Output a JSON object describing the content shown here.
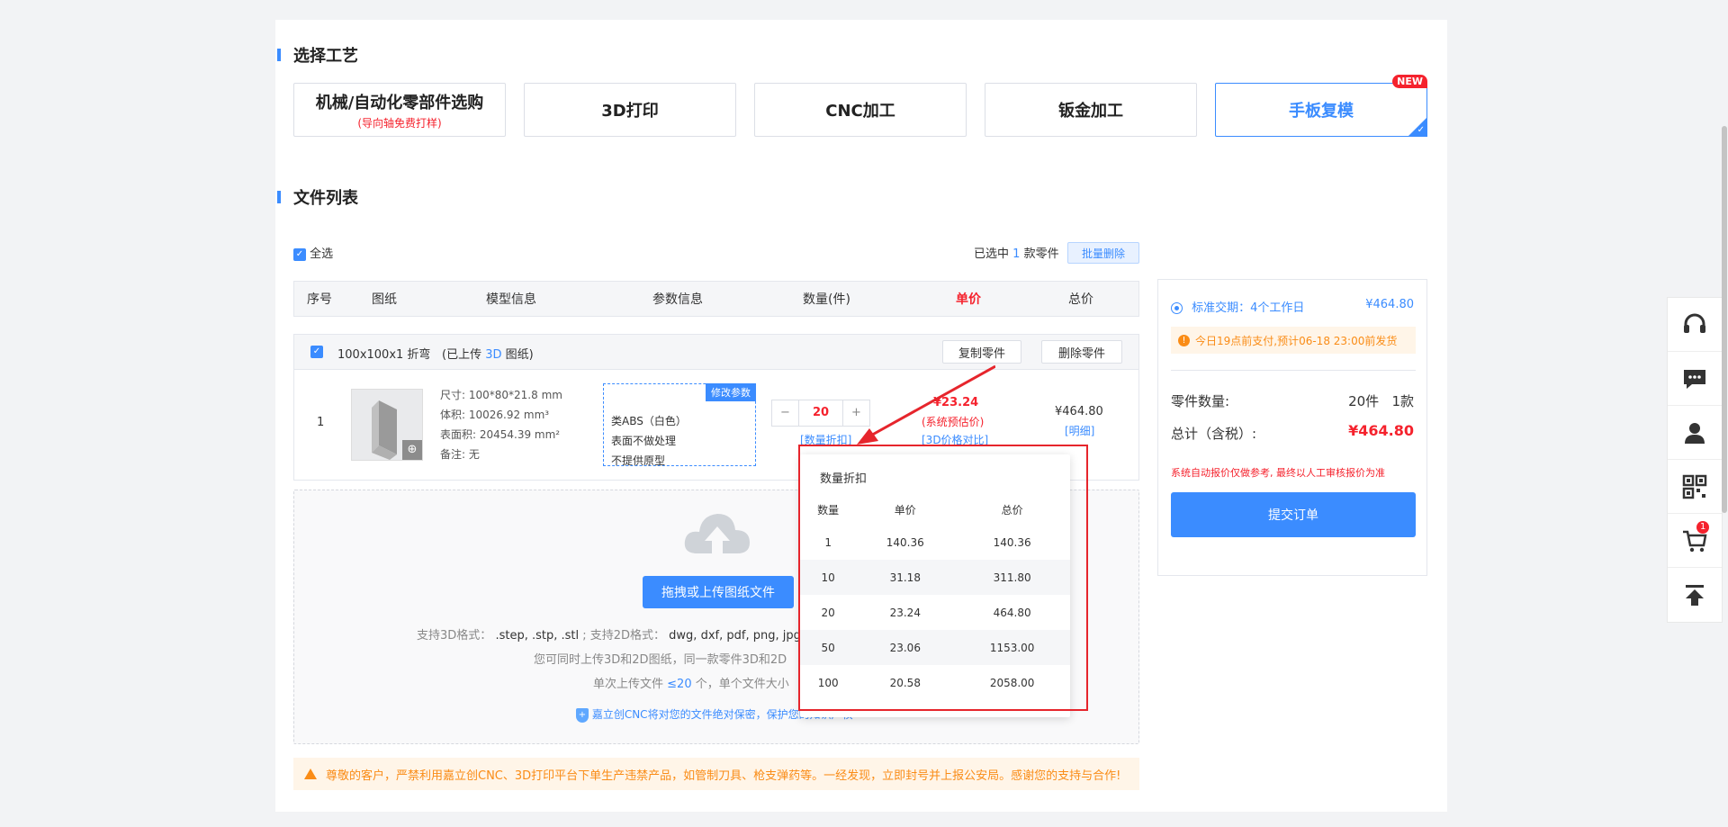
{
  "sections": {
    "process_title": "选择工艺",
    "files_title": "文件列表"
  },
  "processes": [
    {
      "label": "机械/自动化零部件选购",
      "sub": "(导向轴免费打样)"
    },
    {
      "label": "3D打印",
      "sub": ""
    },
    {
      "label": "CNC加工",
      "sub": ""
    },
    {
      "label": "钣金加工",
      "sub": ""
    },
    {
      "label": "手板复模",
      "sub": "",
      "badge": "NEW"
    }
  ],
  "selection": {
    "select_all": "全选",
    "selected_prefix": "已选中",
    "selected_count": "1",
    "selected_suffix": "款零件",
    "batch_delete": "批量删除"
  },
  "table": {
    "headers": [
      "序号",
      "图纸",
      "模型信息",
      "参数信息",
      "数量(件)",
      "单价",
      "总价"
    ]
  },
  "part": {
    "name": "100x100x1 折弯",
    "upload_prefix": "(已上传",
    "upload_link": "3D",
    "upload_suffix": "图纸)",
    "copy_btn": "复制零件",
    "delete_btn": "删除零件",
    "index": "1",
    "size": "尺寸: 100*80*21.8 mm",
    "volume": "体积: 10026.92 mm³",
    "area": "表面积: 20454.39 mm²",
    "remark": "备注: 无",
    "edit_params": "修改参数",
    "params": [
      "类ABS（白色）",
      "表面不做处理",
      "不提供原型"
    ],
    "quantity": "20",
    "qty_discount": "[数量折扣]",
    "unit_price": "¥23.24",
    "price_note": "(系统预估价)",
    "price_compare": "[3D价格对比]",
    "total": "¥464.80",
    "detail": "[明细]"
  },
  "discount_popup": {
    "title": "数量折扣",
    "headers": [
      "数量",
      "单价",
      "总价"
    ],
    "rows": [
      [
        "1",
        "140.36",
        "140.36"
      ],
      [
        "10",
        "31.18",
        "311.80"
      ],
      [
        "20",
        "23.24",
        "464.80"
      ],
      [
        "50",
        "23.06",
        "1153.00"
      ],
      [
        "100",
        "20.58",
        "2058.00"
      ]
    ]
  },
  "upload": {
    "button": "拖拽或上传图纸文件",
    "formats_3d_label": "支持3D格式：",
    "formats_3d": ".step, .stp, .stl",
    "formats_2d_label": "; 支持2D格式：",
    "formats_2d": "dwg, dxf, pdf, png, jpg,",
    "note2": "您可同时上传3D和2D图纸，同一款零件3D和2D",
    "note3_prefix": "单次上传文件",
    "note3_link": "≤20",
    "note3_suffix": "个，单个文件大小",
    "security": "嘉立创CNC将对您的文件绝对保密，保护您的知识产权"
  },
  "warning": "尊敬的客户，严禁利用嘉立创CNC、3D打印平台下单生产违禁产品，如管制刀具、枪支弹药等。一经发现，立即封号并上报公安局。感谢您的支持与合作!",
  "summary": {
    "delivery_label": "标准交期：4个工作日",
    "delivery_price": "¥464.80",
    "notice": "今日19点前支付,预计06-18 23:00前发货",
    "count_label": "零件数量:",
    "count_value": "20件   1款",
    "total_label": "总计（含税）:",
    "total_value": "¥464.80",
    "disclaimer": "系统自动报价仅做参考, 最终以人工审核报价为准",
    "submit": "提交订单"
  },
  "sidebar": {
    "cart_badge": "1"
  },
  "colors": {
    "accent": "#3b8cff",
    "danger": "#f5222d",
    "warn": "#fa8c16"
  }
}
